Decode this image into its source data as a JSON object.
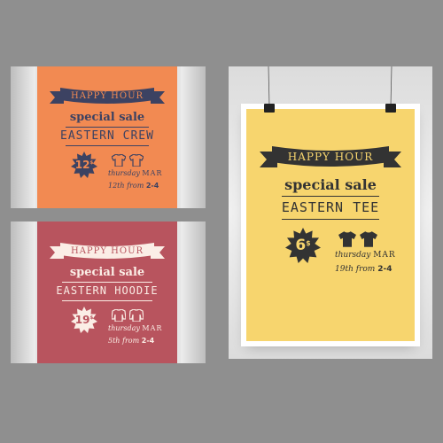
{
  "posters": [
    {
      "id": "orange",
      "bg": "#f28a52",
      "ink": "#3c4262",
      "ribbon": "HAPPY HOUR",
      "special": "special sale",
      "product": "EASTERN CREW",
      "price": "12",
      "price_unit": "$",
      "day": "thursday",
      "month": "MAR",
      "date": "12th",
      "from": "from",
      "time": "2-4"
    },
    {
      "id": "rose",
      "bg": "#b8545e",
      "ink": "#fbeee6",
      "ribbon": "HAPPY HOUR",
      "special": "special sale",
      "product": "EASTERN HOODIE",
      "price": "19",
      "price_unit": "$",
      "day": "thursday",
      "month": "MAR",
      "date": "5th",
      "from": "from",
      "time": "2-4"
    },
    {
      "id": "yellow",
      "bg": "#f7d56e",
      "ink": "#333333",
      "ribbon": "HAPPY HOUR",
      "special": "special sale",
      "product": "EASTERN TEE",
      "price": "6",
      "price_unit": "$",
      "day": "thursday",
      "month": "MAR",
      "date": "19th",
      "from": "from",
      "time": "2-4"
    }
  ],
  "icons": {
    "clip": "binder-clip-icon",
    "badge": "starburst-badge-icon",
    "shirt": "shirt-icon"
  }
}
